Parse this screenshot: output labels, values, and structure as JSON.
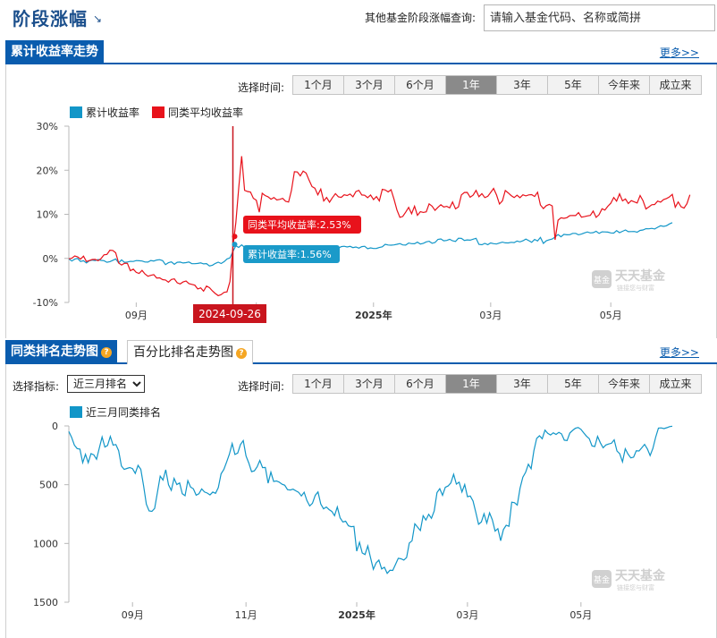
{
  "page": {
    "title": "阶段涨幅",
    "title_arrow": "↘"
  },
  "search": {
    "label": "其他基金阶段涨幅查询:",
    "placeholder": "请输入基金代码、名称或简拼"
  },
  "section1": {
    "tab": "累计收益率走势",
    "more": "更多>>"
  },
  "section2": {
    "tab": "同类排名走势图",
    "tab2": "百分比排名走势图",
    "more": "更多>>",
    "indicator_label": "选择指标:",
    "indicator_value": "近三月排名"
  },
  "range": {
    "label": "选择时间:",
    "options": [
      "1个月",
      "3个月",
      "6个月",
      "1年",
      "3年",
      "5年",
      "今年来",
      "成立来"
    ],
    "active": "1年"
  },
  "watermark": {
    "brand": "天天基金",
    "sub": "链接您与财富",
    "badge": "基金"
  },
  "colors": {
    "accent": "#0a5cae",
    "series_cum": "#1296c8",
    "series_avg": "#e8121b",
    "tooltip_cum_bg": "#1a9ac9",
    "tooltip_avg_bg": "#e8121b",
    "date_flag_bg": "#c9151e"
  },
  "chart_data": [
    {
      "type": "line",
      "title": "",
      "legend": [
        "累计收益率",
        "同类平均收益率"
      ],
      "y_ticks": [
        "30%",
        "20%",
        "10%",
        "0%",
        "-10%"
      ],
      "ylim": [
        -10,
        30
      ],
      "x_ticks": [
        {
          "label": "09月",
          "bold": false
        },
        {
          "label": "11月",
          "bold": false
        },
        {
          "label": "2025年",
          "bold": true
        },
        {
          "label": "03月",
          "bold": false
        },
        {
          "label": "05月",
          "bold": false
        }
      ],
      "x_tick_index": [
        23,
        64,
        104,
        144,
        185
      ],
      "tooltip": {
        "date": "2024-09-26",
        "index": 56,
        "avg_label": "同类平均收益率:2.53%",
        "cum_label": "累计收益率:1.56%",
        "avg": 2.53,
        "cum": 1.56
      },
      "series": [
        {
          "name": "累计收益率",
          "color": "#1296c8",
          "values": [
            -0.12,
            -0.6,
            -0.17,
            0.0,
            -0.71,
            -0.53,
            -1.05,
            -0.54,
            -0.4,
            -0.51,
            -0.26,
            -0.46,
            -0.52,
            -0.89,
            -0.75,
            -0.43,
            -0.13,
            -1.0,
            -0.33,
            -0.91,
            -0.83,
            -0.69,
            -0.7,
            -0.5,
            -0.54,
            -0.6,
            -0.82,
            -0.85,
            -0.48,
            -0.6,
            -0.37,
            -0.3,
            -0.51,
            -1.42,
            -0.99,
            -0.81,
            -1.36,
            -0.89,
            -0.85,
            -1.04,
            -0.96,
            -0.82,
            -1.18,
            -1.21,
            -1.14,
            -1.02,
            -1.24,
            -1.18,
            -1.71,
            -1.56,
            -1.14,
            -0.87,
            -1.17,
            -0.75,
            -0.14,
            0.12,
            1.56,
            2.85,
            2.49,
            3.06,
            2.5,
            2.39,
            2.67,
            2.52,
            1.8,
            2.22,
            1.9,
            2.44,
            2.08,
            2.05,
            1.83,
            1.37,
            2.35,
            2.33,
            1.84,
            2.31,
            2.29,
            1.74,
            2.15,
            2.05,
            1.86,
            2.16,
            1.49,
            1.97,
            2.31,
            2.12,
            2.54,
            2.37,
            2.15,
            2.35,
            2.46,
            2.8,
            2.29,
            2.66,
            2.76,
            2.59,
            2.74,
            2.44,
            2.59,
            2.33,
            2.68,
            2.75,
            2.19,
            2.39,
            2.24,
            2.26,
            2.46,
            2.62,
            3.2,
            3.04,
            2.99,
            3.06,
            3.2,
            3.36,
            3.05,
            3.01,
            3.49,
            3.34,
            3.31,
            3.68,
            3.25,
            3.43,
            3.75,
            3.88,
            3.42,
            3.6,
            4.32,
            4.42,
            3.98,
            4.08,
            4.33,
            3.98,
            3.84,
            4.57,
            4.53,
            4.08,
            4.2,
            4.14,
            4.36,
            4.56,
            3.18,
            3.1,
            3.4,
            3.11,
            3.5,
            3.34,
            3.25,
            3.48,
            3.68,
            3.52,
            3.5,
            3.64,
            3.59,
            3.93,
            3.74,
            3.98,
            4.38,
            4.04,
            3.65,
            4.29,
            3.95,
            4.77,
            3.41,
            4.02,
            4.24,
            4.39,
            4.84,
            5.41,
            4.91,
            5.45,
            5.36,
            5.38,
            5.68,
            5.68,
            5.35,
            5.52,
            5.77,
            6.01,
            5.77,
            5.83,
            6.16,
            5.68,
            6.02,
            6.01,
            5.95,
            5.78,
            5.73,
            6.31,
            5.84,
            6.15,
            6.44,
            6.07,
            6.09,
            6.11,
            5.93,
            6.35,
            6.45,
            6.73,
            6.72,
            6.82,
            6.68,
            7.06,
            7.4,
            7.25,
            7.41,
            7.81,
            8.11
          ]
        },
        {
          "name": "同类平均收益率",
          "color": "#e8121b",
          "values": [
            -0.11,
            0.03,
            0.56,
            0.36,
            -0.18,
            0.49,
            -0.73,
            -0.5,
            -0.25,
            -0.23,
            -0.52,
            -0.05,
            0.81,
            0.91,
            1.86,
            1.8,
            1.26,
            -1.05,
            -1.51,
            -1.11,
            -1.12,
            -2.79,
            -2.44,
            -3.17,
            -3.43,
            -2.74,
            -3.55,
            -4.05,
            -3.85,
            -3.69,
            -4.46,
            -4.41,
            -4.82,
            -4.91,
            -5.39,
            -4.78,
            -4.66,
            -5.53,
            -5.79,
            -5.36,
            -5.12,
            -5.73,
            -5.9,
            -6.08,
            -6.93,
            -6.69,
            -7.44,
            -6.29,
            -6.64,
            -7.39,
            -7.96,
            -8.45,
            -8.21,
            -7.7,
            -7.6,
            -5.26,
            2.53,
            8.11,
            15.93,
            23.2,
            15.44,
            15.18,
            15.05,
            13.64,
            13.18,
            10.48,
            14.78,
            14.27,
            13.97,
            13.43,
            13.81,
            13.25,
            13.39,
            13.61,
            12.97,
            12.79,
            15.42,
            19.67,
            19.6,
            18.74,
            19.8,
            19.36,
            17.75,
            16.3,
            15.93,
            14.43,
            15.72,
            13.02,
            13.82,
            12.74,
            13.79,
            14.7,
            13.98,
            13.83,
            14.42,
            14.27,
            14.61,
            13.98,
            15.15,
            15.44,
            14.38,
            14.33,
            13.78,
            14.39,
            13.35,
            14.02,
            13.05,
            15.67,
            15.52,
            15.08,
            15.58,
            13.43,
            10.98,
            9.3,
            9.51,
            10.49,
            11.57,
            10.14,
            11.85,
            9.77,
            10.59,
            10.43,
            10.57,
            12.37,
            11.84,
            10.89,
            11.59,
            12.18,
            11.67,
            11.8,
            11.47,
            12.81,
            11.23,
            11.66,
            14.4,
            14.95,
            14.98,
            13.88,
            14.35,
            15.42,
            14.01,
            14.7,
            13.8,
            14.08,
            14.95,
            15.87,
            14.38,
            12.34,
            13.06,
            15.4,
            14.85,
            14.24,
            13.79,
            14.33,
            13.78,
            14.43,
            14.19,
            14.4,
            14.46,
            14.05,
            15.01,
            12.12,
            11.29,
            11.96,
            12.26,
            11.9,
            4.21,
            8.65,
            9.2,
            9.09,
            9.23,
            9.7,
            9.74,
            9.72,
            10.38,
            9.35,
            9.47,
            9.63,
            9.75,
            10.73,
            9.3,
            9.92,
            11.25,
            10.95,
            11.83,
            12.51,
            13.82,
            12.99,
            14.64,
            13.05,
            13.5,
            12.46,
            13.1,
            12.83,
            12.58,
            14.26,
            13.1,
            11.22,
            11.68,
            12.17,
            12.24,
            13.0,
            12.77,
            13.36,
            13.57,
            13.93,
            14.52,
            11.61,
            12.8,
            11.73,
            11.4,
            12.41,
            14.43
          ]
        }
      ]
    },
    {
      "type": "line",
      "title": "",
      "legend": [
        "近三月同类排名"
      ],
      "y_ticks": [
        "0",
        "500",
        "1000",
        "1500"
      ],
      "ylim": [
        0,
        1500
      ],
      "y_inverted": true,
      "x_ticks": [
        {
          "label": "09月",
          "bold": false
        },
        {
          "label": "11月",
          "bold": false
        },
        {
          "label": "2025年",
          "bold": true
        },
        {
          "label": "03月",
          "bold": false
        },
        {
          "label": "05月",
          "bold": false
        }
      ],
      "x_tick_index": [
        23,
        64,
        104,
        144,
        185
      ],
      "series": [
        {
          "name": "近三月同类排名",
          "color": "#1296c8",
          "values": [
            48,
            97,
            164,
            193,
            197,
            313,
            241,
            313,
            235,
            246,
            283,
            187,
            94,
            180,
            166,
            89,
            163,
            158,
            211,
            341,
            370,
            362,
            354,
            363,
            404,
            336,
            369,
            509,
            666,
            723,
            727,
            701,
            565,
            427,
            461,
            373,
            501,
            548,
            446,
            499,
            485,
            577,
            594,
            466,
            521,
            535,
            589,
            577,
            536,
            562,
            571,
            587,
            563,
            573,
            525,
            407,
            370,
            307,
            240,
            150,
            243,
            231,
            158,
            125,
            256,
            316,
            389,
            382,
            348,
            294,
            355,
            353,
            487,
            394,
            473,
            468,
            478,
            496,
            505,
            542,
            545,
            538,
            552,
            565,
            596,
            564,
            635,
            681,
            658,
            591,
            561,
            665,
            705,
            690,
            712,
            728,
            764,
            690,
            782,
            817,
            811,
            850,
            857,
            855,
            1065,
            990,
            1081,
            1094,
            1021,
            1122,
            1220,
            1166,
            1141,
            1217,
            1203,
            1255,
            1228,
            1230,
            1178,
            1126,
            1131,
            1141,
            1120,
            997,
            977,
            833,
            861,
            890,
            764,
            801,
            752,
            786,
            723,
            567,
            534,
            591,
            522,
            511,
            485,
            412,
            495,
            478,
            562,
            499,
            602,
            596,
            638,
            735,
            837,
            818,
            747,
            827,
            739,
            799,
            895,
            874,
            977,
            882,
            845,
            854,
            649,
            653,
            674,
            530,
            436,
            395,
            326,
            364,
            210,
            106,
            84,
            109,
            36,
            63,
            77,
            59,
            72,
            55,
            68,
            121,
            124,
            60,
            38,
            20,
            14,
            29,
            59,
            87,
            108,
            170,
            175,
            89,
            143,
            186,
            162,
            154,
            148,
            119,
            213,
            237,
            305,
            194,
            240,
            272,
            266,
            212,
            213,
            186,
            157,
            196,
            252,
            191,
            96,
            18,
            17,
            23,
            15,
            6,
            2
          ]
        }
      ]
    }
  ]
}
